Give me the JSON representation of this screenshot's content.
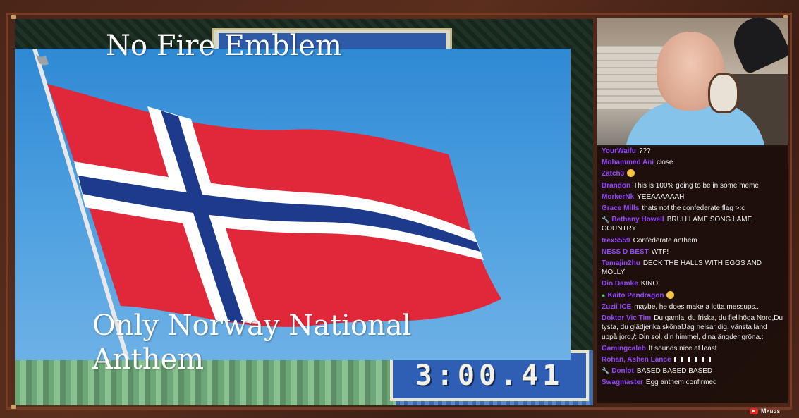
{
  "overlay": {
    "top_caption": "No Fire Emblem",
    "bottom_caption": "Only Norway National Anthem"
  },
  "game": {
    "timer": "3:00.41"
  },
  "flag": {
    "country": "Norway",
    "colors": {
      "red": "#e0283a",
      "white": "#ffffff",
      "blue": "#1d3a8c"
    }
  },
  "chat": {
    "messages": [
      {
        "user": "YourWaifu",
        "text": "???",
        "badge": ""
      },
      {
        "user": "Mohammed Ani",
        "text": "close",
        "badge": ""
      },
      {
        "user": "Zatch3",
        "text": "",
        "badge": "",
        "emote": "emoji-icon"
      },
      {
        "user": "Brandon",
        "text": "This is 100% going to be in some meme",
        "badge": ""
      },
      {
        "user": "MorkerNk",
        "text": "YEEAAAAAAH",
        "badge": ""
      },
      {
        "user": "Grace Mills",
        "text": "thats not the confederate flag >:c",
        "badge": ""
      },
      {
        "user": "Bethany Howell",
        "text": "BRUH LAME SONG LAME COUNTRY",
        "badge": "wrench"
      },
      {
        "user": "trex5559",
        "text": "Confederate anthem",
        "badge": ""
      },
      {
        "user": "NESS D BEST",
        "text": "WTF!",
        "badge": ""
      },
      {
        "user": "Temajin2hu",
        "text": "DECK THE HALLS WITH EGGS AND MOLLY",
        "badge": ""
      },
      {
        "user": "Dio Damke",
        "text": "KINO",
        "badge": ""
      },
      {
        "user": "Kaito Pendragon",
        "text": "",
        "badge": "green",
        "emote": "emoji-icon"
      },
      {
        "user": "Zuzii ICE",
        "text": "maybe, he does make a lotta messups..",
        "badge": ""
      },
      {
        "user": "Doktor Vic Tim",
        "text": "Du gamla, du friska, du fjellhöga Nord,Du tysta, du glädjerika sköna!Jag helsar dig, vänsta land uppå jord,/: Din sol, din himmel, dina ängder gröna.:",
        "badge": ""
      },
      {
        "user": "Gamingcaleb",
        "text": "It sounds nice at least",
        "badge": ""
      },
      {
        "user": "Rohan, Ashen Lance",
        "text": "",
        "badge": "",
        "bars": true
      },
      {
        "user": "Donlot",
        "text": "BASED BASED BASED",
        "badge": "wrench"
      },
      {
        "user": "Swagmaster",
        "text": "Egg anthem confirmed",
        "badge": ""
      }
    ]
  },
  "branding": {
    "label": "Mangs",
    "icon": "youtube-icon"
  }
}
